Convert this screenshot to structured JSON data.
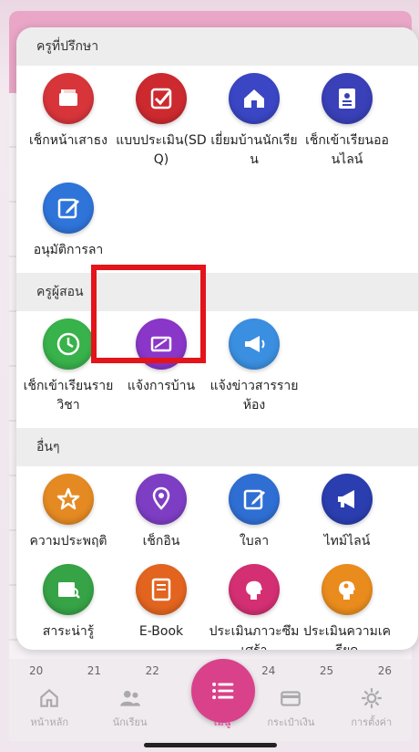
{
  "sections": [
    {
      "title": "ครูที่ปรึกษา",
      "items": [
        {
          "label": "เช็กหน้าเสาธง",
          "icon": "flag-pole-icon",
          "color": "#d8353b"
        },
        {
          "label": "แบบประเมิน(SDQ)",
          "icon": "checkbox-icon",
          "color": "#cc2a2f"
        },
        {
          "label": "เยี่ยมบ้านนักเรียน",
          "icon": "home-visit-icon",
          "color": "#3a46c4"
        },
        {
          "label": "เช็กเข้าเรียนออนไลน์",
          "icon": "online-checkin-icon",
          "color": "#3940b8"
        },
        {
          "label": "อนุมัติการลา",
          "icon": "approve-leave-icon",
          "color": "#2f74d9"
        }
      ]
    },
    {
      "title": "ครูผู้สอน",
      "items": [
        {
          "label": "เช็กเข้าเรียนรายวิชา",
          "icon": "clock-icon",
          "color": "#38b24a"
        },
        {
          "label": "แจ้งการบ้าน",
          "icon": "homework-icon",
          "color": "#8a36c8"
        },
        {
          "label": "แจ้งข่าวสารรายห้อง",
          "icon": "megaphone-icon",
          "color": "#3b8fe0"
        }
      ]
    },
    {
      "title": "อื่นๆ",
      "items": [
        {
          "label": "ความประพฤติ",
          "icon": "star-icon",
          "color": "#e58a22"
        },
        {
          "label": "เช็กอิน",
          "icon": "location-pin-icon",
          "color": "#7e3ec4"
        },
        {
          "label": "ใบลา",
          "icon": "edit-form-icon",
          "color": "#2f6fd4"
        },
        {
          "label": "ไทม์ไลน์",
          "icon": "announcement-icon",
          "color": "#2a3eb0"
        },
        {
          "label": "สาระน่ารู้",
          "icon": "book-search-icon",
          "color": "#36a346"
        },
        {
          "label": "E-Book",
          "icon": "ebook-icon",
          "color": "#e2641f"
        },
        {
          "label": "ประเมินภาวะซึมเศร้า",
          "icon": "head-icon",
          "color": "#d42f73"
        },
        {
          "label": "ประเมินความเครียด",
          "icon": "stress-icon",
          "color": "#ea8c1d"
        }
      ]
    }
  ],
  "dates": [
    "20",
    "21",
    "22",
    "23",
    "24",
    "25",
    "26"
  ],
  "bottom_nav": {
    "home": "หน้าหลัก",
    "students": "นักเรียน",
    "menu": "เมนู",
    "wallet": "กระเป๋าเงิน",
    "settings": "การตั้งค่า"
  },
  "colors": {
    "highlight": "#e3141a",
    "accent": "#d9418b"
  }
}
